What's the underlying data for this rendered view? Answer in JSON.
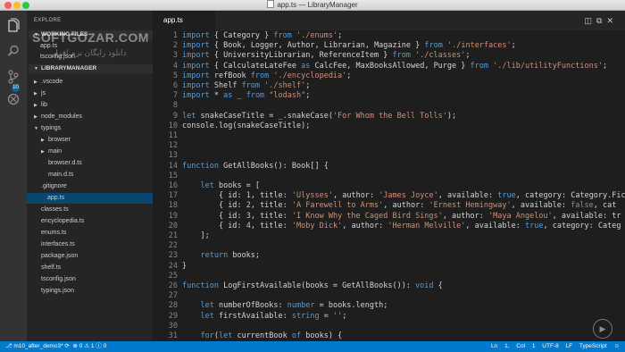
{
  "window": {
    "title": "app.ts — LibraryManager"
  },
  "activity_bar": {
    "badge_count": "10"
  },
  "sidebar": {
    "explore_label": "EXPLORE",
    "working_files_label": "WORKING FILES",
    "working_files": [
      "app.ts",
      "tsconfig.json"
    ],
    "project_label": "LIBRARYMANAGER",
    "tree": [
      {
        "label": ".vscode",
        "folder": true,
        "open": false,
        "indent": 1
      },
      {
        "label": "js",
        "folder": true,
        "open": false,
        "indent": 1
      },
      {
        "label": "lib",
        "folder": true,
        "open": false,
        "indent": 1
      },
      {
        "label": "node_modules",
        "folder": true,
        "open": false,
        "indent": 1
      },
      {
        "label": "typings",
        "folder": true,
        "open": true,
        "indent": 1
      },
      {
        "label": "browser",
        "folder": true,
        "open": false,
        "indent": 2
      },
      {
        "label": "main",
        "folder": true,
        "open": false,
        "indent": 2
      },
      {
        "label": "browser.d.ts",
        "folder": false,
        "indent": 2
      },
      {
        "label": "main.d.ts",
        "folder": false,
        "indent": 2
      },
      {
        "label": ".gitignore",
        "folder": false,
        "indent": 1
      },
      {
        "label": "app.ts",
        "folder": false,
        "indent": 1,
        "active": true
      },
      {
        "label": "classes.ts",
        "folder": false,
        "indent": 1
      },
      {
        "label": "encyclopedia.ts",
        "folder": false,
        "indent": 1
      },
      {
        "label": "enums.ts",
        "folder": false,
        "indent": 1
      },
      {
        "label": "interfaces.ts",
        "folder": false,
        "indent": 1
      },
      {
        "label": "package.json",
        "folder": false,
        "indent": 1
      },
      {
        "label": "shelf.ts",
        "folder": false,
        "indent": 1
      },
      {
        "label": "tsconfig.json",
        "folder": false,
        "indent": 1
      },
      {
        "label": "typings.json",
        "folder": false,
        "indent": 1
      }
    ]
  },
  "editor": {
    "tab_label": "app.ts",
    "lines": [
      "import { Category } from './enums';",
      "import { Book, Logger, Author, Librarian, Magazine } from './interfaces';",
      "import { UniversityLibrarian, ReferenceItem } from './classes';",
      "import { CalculateLateFee as CalcFee, MaxBooksAllowed, Purge } from './lib/utilityFunctions';",
      "import refBook from './encyclopedia';",
      "import Shelf from './shelf';",
      "import * as _ from \"lodash\";",
      "",
      "let snakeCaseTitle = _.snakeCase('For Whom the Bell Tolls');",
      "console.log(snakeCaseTitle);",
      "",
      "",
      "",
      "function GetAllBooks(): Book[] {",
      "",
      "    let books = [",
      "        { id: 1, title: 'Ulysses', author: 'James Joyce', available: true, category: Category.Fic",
      "        { id: 2, title: 'A Farewell to Arms', author: 'Ernest Hemingway', available: false, cat",
      "        { id: 3, title: 'I Know Why the Caged Bird Sings', author: 'Maya Angelou', available: tr",
      "        { id: 4, title: 'Moby Dick', author: 'Herman Melville', available: true, category: Categ",
      "    ];",
      "",
      "    return books;",
      "}",
      "",
      "function LogFirstAvailable(books = GetAllBooks()): void {",
      "",
      "    let numberOfBooks: number = books.length;",
      "    let firstAvailable: string = '';",
      "",
      "    for(let currentBook of books) {"
    ]
  },
  "status_bar": {
    "branch": "m10_after_demo3*",
    "errors": "0",
    "warnings": "1",
    "alerts": "0",
    "position": "Ln 1, Col 1",
    "encoding": "UTF-8",
    "eol": "LF",
    "language": "TypeScript"
  },
  "watermark": {
    "main": "SOFTGOZAR.COM",
    "sub": "دانلود رایگان نرم افزار"
  },
  "colors": {
    "accent": "#007acc",
    "keyword": "#569cd6",
    "string": "#ce9178",
    "number": "#b5cea8",
    "selection": "#094771"
  },
  "icons": [
    "files-icon",
    "search-icon",
    "git-icon",
    "debug-icon"
  ]
}
